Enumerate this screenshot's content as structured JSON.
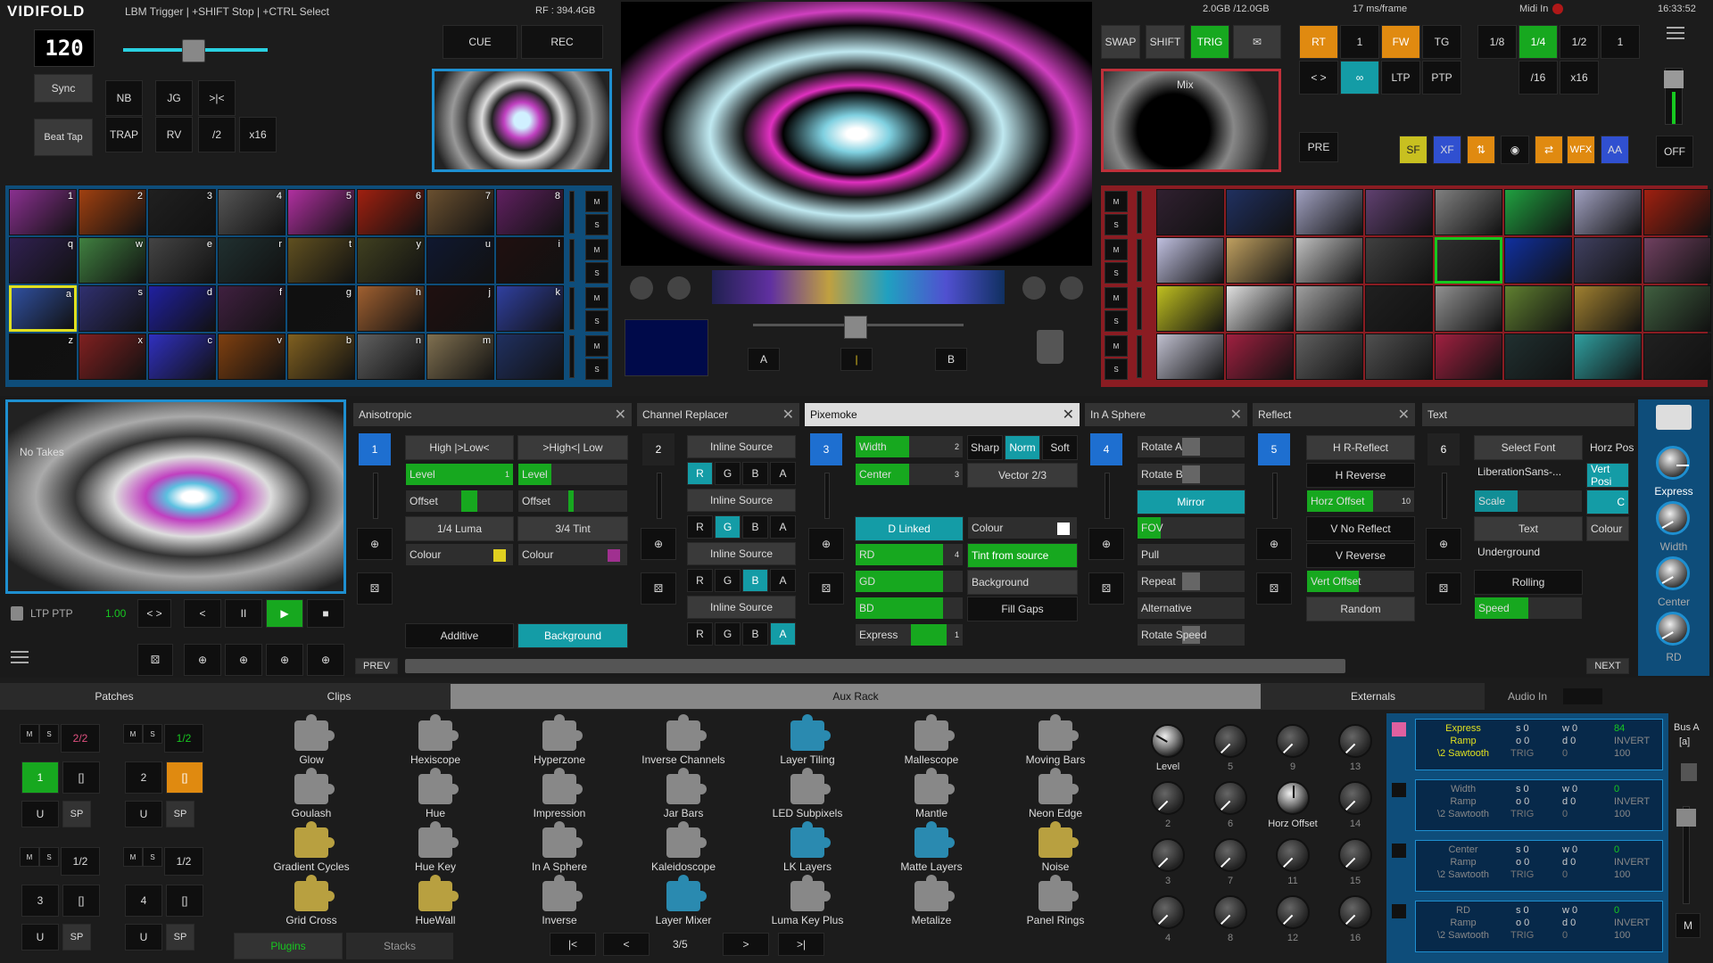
{
  "app": {
    "title": "VIDIFOLD",
    "subtitle": "LBM Trigger | +SHIFT Stop | +CTRL Select",
    "rf": "RF : 394.4GB",
    "mem": "2.0GB /12.0GB",
    "frame": "17 ms/frame",
    "midi": "Midi In",
    "time": "16:33:52"
  },
  "tempo": {
    "bpm": "120",
    "sync": "Sync",
    "beat_tap": "Beat Tap"
  },
  "left_buttons": {
    "nb": "NB",
    "jg": "JG",
    "cut": ">|<",
    "trap": "TRAP",
    "rv": "RV",
    "half": "/2",
    "x16": "x16",
    "cue": "CUE",
    "rec": "REC"
  },
  "right_buttons": {
    "swap": "SWAP",
    "shift": "SHIFT",
    "trig": "TRIG",
    "rt": "RT",
    "one": "1",
    "fw": "FW",
    "tg": "TG",
    "eighth": "1/8",
    "quarter": "1/4",
    "half": "1/2",
    "one_b": "1",
    "ab": "< >",
    "ltp": "LTP",
    "ptp": "PTP",
    "div16": "/16",
    "x16": "x16",
    "pre": "PRE",
    "sf": "SF",
    "xf": "XF",
    "wfx": "WFX",
    "aa": "AA",
    "off": "OFF",
    "mix": "Mix"
  },
  "crossfader": {
    "a": "A",
    "b": "B",
    "mid": "|"
  },
  "left_bank_keys": [
    "1",
    "2",
    "3",
    "4",
    "5",
    "6",
    "7",
    "8",
    "q",
    "w",
    "e",
    "r",
    "t",
    "y",
    "u",
    "i",
    "a",
    "s",
    "d",
    "f",
    "g",
    "h",
    "j",
    "k",
    "z",
    "x",
    "c",
    "v",
    "b",
    "n",
    "m",
    ""
  ],
  "ms": {
    "m": "M",
    "s": "S"
  },
  "preview": {
    "no_takes": "No Takes",
    "ltp_ptp": "LTP PTP",
    "value": "1.00",
    "ab": "< >",
    "prev_btn": "<",
    "pause": "II",
    "play": "▶",
    "stop": "■"
  },
  "effects": {
    "anisotropic": {
      "title": "Anisotropic",
      "ch": "1",
      "b1": "High |>Low<",
      "b2": ">High<| Low",
      "level": "Level",
      "level_val": "1",
      "level2": "Level",
      "offset": "Offset",
      "offset2": "Offset",
      "luma": "1/4 Luma",
      "tint": "3/4 Tint",
      "colour": "Colour",
      "colour2": "Colour",
      "additive": "Additive",
      "background": "Background"
    },
    "channel_replacer": {
      "title": "Channel Replacer",
      "ch": "2",
      "inline": "Inline Source",
      "r": "R",
      "g": "G",
      "b": "B",
      "a": "A"
    },
    "pixemoke": {
      "title": "Pixemoke",
      "ch": "3",
      "width": "Width",
      "width_val": "2",
      "sharp": "Sharp",
      "norm": "Norm",
      "soft": "Soft",
      "center": "Center",
      "center_val": "3",
      "vector": "Vector 2/3",
      "dlinked": "D Linked",
      "colour": "Colour",
      "rd": "RD",
      "rd_val": "4",
      "tint": "Tint from source",
      "gd": "GD",
      "background": "Background",
      "bd": "BD",
      "fillgaps": "Fill Gaps",
      "express": "Express",
      "express_val": "1"
    },
    "in_a_sphere": {
      "title": "In A Sphere",
      "ch": "4",
      "rotate_a": "Rotate A",
      "rotate_b": "Rotate B",
      "mirror": "Mirror",
      "fov": "FOV",
      "pull": "Pull",
      "repeat": "Repeat",
      "alternative": "Alternative",
      "rotate_speed": "Rotate Speed"
    },
    "reflect": {
      "title": "Reflect",
      "ch": "5",
      "hr": "H R-Reflect",
      "hrev": "H Reverse",
      "horz": "Horz Offset",
      "horz_val": "10",
      "vno": "V No Reflect",
      "vrev": "V Reverse",
      "vert": "Vert Offset",
      "random": "Random"
    },
    "text": {
      "title": "Text",
      "ch": "6",
      "select_font": "Select Font",
      "font": "LiberationSans-...",
      "horz_pos": "Horz Pos",
      "vert_pos": "Vert Posi",
      "scale": "Scale",
      "c": "C",
      "text": "Text",
      "colour": "Colour",
      "underground": "Underground",
      "rolling": "Rolling",
      "speed": "Speed"
    },
    "prev": "PREV",
    "next": "NEXT"
  },
  "right_knobs": [
    "Express",
    "Width",
    "Center",
    "RD"
  ],
  "tabs": {
    "patches": "Patches",
    "clips": "Clips",
    "aux": "Aux Rack",
    "externals": "Externals",
    "audio": "Audio In"
  },
  "patches": [
    {
      "id": "1",
      "count": "2/2",
      "label": "1",
      "link": "[]"
    },
    {
      "id": "2",
      "count": "1/2",
      "label": "2",
      "link": "[]"
    },
    {
      "id": "3",
      "count": "1/2",
      "label": "3",
      "link": "[]"
    },
    {
      "id": "4",
      "count": "1/2",
      "label": "4",
      "link": "[]"
    }
  ],
  "patch_u": "U",
  "patch_sp": "SP",
  "plugins": [
    "Glow",
    "Hexiscope",
    "Hyperzone",
    "Inverse Channels",
    "Layer Tiling",
    "Mallescope",
    "Moving Bars",
    "Goulash",
    "Hue",
    "Impression",
    "Jar Bars",
    "LED Subpixels",
    "Mantle",
    "Neon Edge",
    "Gradient Cycles",
    "Hue Key",
    "In A Sphere",
    "Kaleidoscope",
    "LK Layers",
    "Matte Layers",
    "Noise",
    "Grid Cross",
    "HueWall",
    "Inverse",
    "Layer Mixer",
    "Luma Key Plus",
    "Metalize",
    "Panel Rings"
  ],
  "plugin_colors": [
    "#888",
    "#888",
    "#888",
    "#888",
    "#2a8ab0",
    "#888",
    "#888",
    "#888",
    "#888",
    "#888",
    "#888",
    "#888",
    "#888",
    "#888",
    "#b8a040",
    "#888",
    "#888",
    "#888",
    "#2a8ab0",
    "#2a8ab0",
    "#b8a040",
    "#b8a040",
    "#b8a040",
    "#888",
    "#2a8ab0",
    "#888",
    "#888",
    "#888"
  ],
  "plugin_nav": {
    "plugins": "Plugins",
    "stacks": "Stacks",
    "first": "|<",
    "prev": "<",
    "page": "3/5",
    "next": ">",
    "last": ">|"
  },
  "rack_knobs": [
    "Level",
    "5",
    "9",
    "13",
    "2",
    "6",
    "Horz Offset",
    "14",
    "3",
    "7",
    "11",
    "15",
    "4",
    "8",
    "12",
    "16"
  ],
  "modulators": [
    {
      "name": "Express",
      "type": "Ramp",
      "wave": "\\2 Sawtooth",
      "s": "s 0",
      "o": "o 0",
      "w": "w 0",
      "d": "d 0",
      "v": "84",
      "inv": "INVERT",
      "trig": "TRIG",
      "t": "0",
      "n": "100"
    },
    {
      "name": "Width",
      "type": "Ramp",
      "wave": "\\2 Sawtooth",
      "s": "s 0",
      "o": "o 0",
      "w": "w 0",
      "d": "d 0",
      "v": "0",
      "inv": "INVERT",
      "trig": "TRIG",
      "t": "0",
      "n": "100"
    },
    {
      "name": "Center",
      "type": "Ramp",
      "wave": "\\2 Sawtooth",
      "s": "s 0",
      "o": "o 0",
      "w": "w 0",
      "d": "d 0",
      "v": "0",
      "inv": "INVERT",
      "trig": "TRIG",
      "t": "0",
      "n": "100"
    },
    {
      "name": "RD",
      "type": "Ramp",
      "wave": "\\2 Sawtooth",
      "s": "s 0",
      "o": "o 0",
      "w": "w 0",
      "d": "d 0",
      "v": "0",
      "inv": "INVERT",
      "trig": "TRIG",
      "t": "0",
      "n": "100"
    }
  ],
  "bus": {
    "label": "Bus A",
    "sub": "[a]",
    "m": "M"
  }
}
